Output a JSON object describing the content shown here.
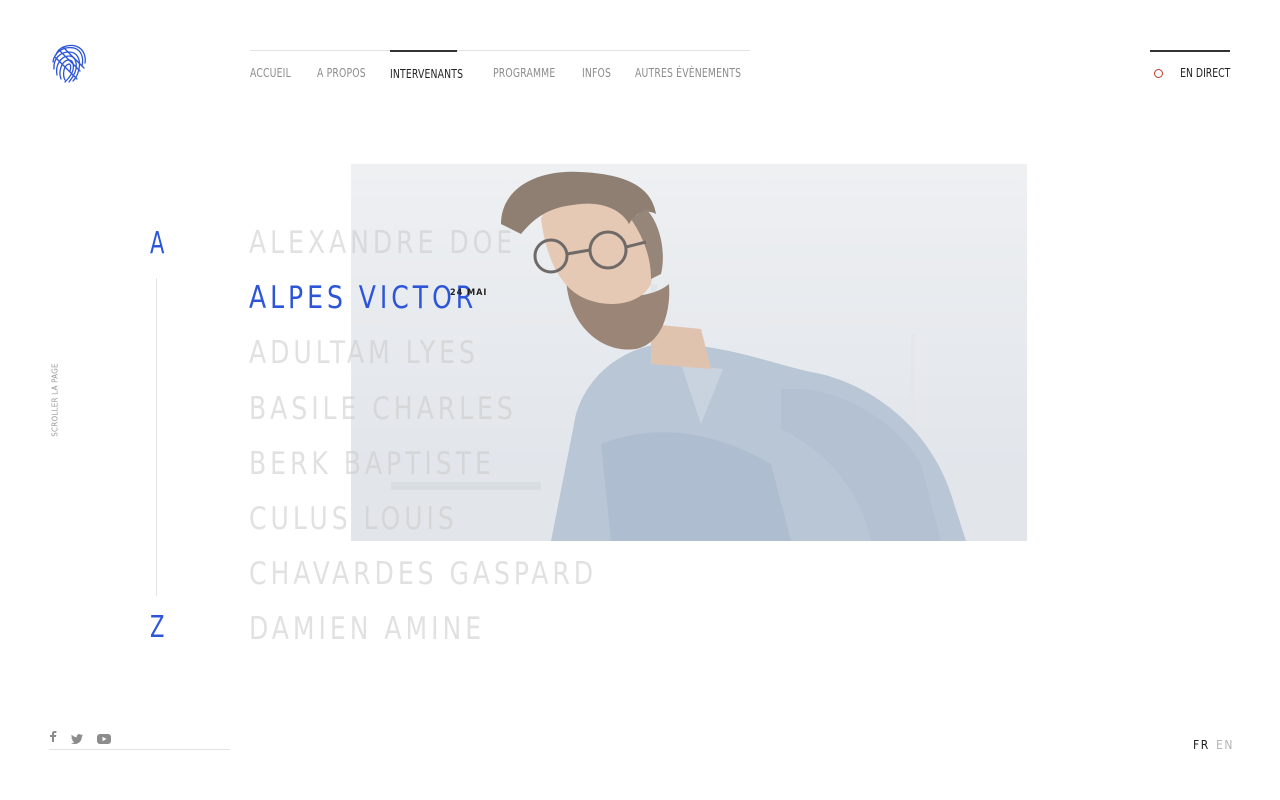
{
  "nav": {
    "items": [
      {
        "label": "ACCUEIL"
      },
      {
        "label": "A PROPOS"
      },
      {
        "label": "INTERVENANTS"
      },
      {
        "label": "PROGRAMME"
      },
      {
        "label": "INFOS"
      },
      {
        "label": "AUTRES ÉVÈNEMENTS"
      }
    ],
    "active": "INTERVENANTS",
    "live_label": "EN DIRECT"
  },
  "alphabet": {
    "start": "A",
    "end": "Z"
  },
  "scroll_hint": "SCROLLER LA PAGE",
  "speakers": [
    {
      "name": "ALEXANDRE DOE"
    },
    {
      "name": "ALPES VICTOR",
      "date": "24 MAI",
      "active": true
    },
    {
      "name": "ADULTAM LYES"
    },
    {
      "name": "BASILE CHARLES"
    },
    {
      "name": "BERK BAPTISTE"
    },
    {
      "name": "CULUS LOUIS"
    },
    {
      "name": "CHAVARDES GASPARD"
    },
    {
      "name": "DAMIEN AMINE"
    }
  ],
  "social": {
    "icons": [
      "facebook-icon",
      "twitter-icon",
      "youtube-icon"
    ]
  },
  "languages": {
    "fr": "FR",
    "en": "EN",
    "selected": "FR"
  },
  "colors": {
    "accent": "#2d55d8",
    "live": "#c0392b",
    "text": "#222222",
    "muted": "#8c8c8c"
  }
}
